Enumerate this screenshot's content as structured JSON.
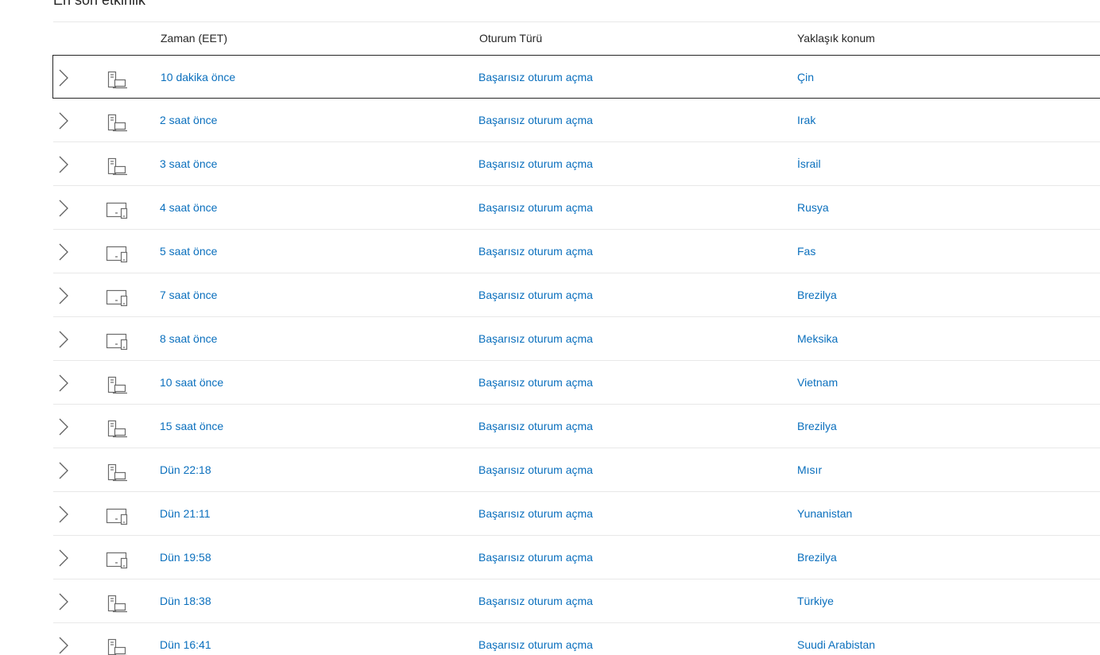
{
  "section": {
    "title": "En son etkinlik"
  },
  "columns": {
    "time": "Zaman (EET)",
    "session_type": "Oturum Türü",
    "location": "Yaklaşık konum"
  },
  "colors": {
    "link": "#0a6fbd",
    "text": "#262626",
    "divider": "#e8e8e8",
    "icon": "#6b6b6b"
  },
  "rows": [
    {
      "time": "10 dakika önce",
      "type": "Başarısız oturum açma",
      "location": "Çin",
      "device_icon": "desktop-laptop-icon"
    },
    {
      "time": "2 saat önce",
      "type": "Başarısız oturum açma",
      "location": "Irak",
      "device_icon": "desktop-laptop-icon"
    },
    {
      "time": "3 saat önce",
      "type": "Başarısız oturum açma",
      "location": "İsrail",
      "device_icon": "desktop-laptop-icon"
    },
    {
      "time": "4 saat önce",
      "type": "Başarısız oturum açma",
      "location": "Rusya",
      "device_icon": "monitor-phone-icon"
    },
    {
      "time": "5 saat önce",
      "type": "Başarısız oturum açma",
      "location": "Fas",
      "device_icon": "monitor-phone-icon"
    },
    {
      "time": "7 saat önce",
      "type": "Başarısız oturum açma",
      "location": "Brezilya",
      "device_icon": "monitor-phone-icon"
    },
    {
      "time": "8 saat önce",
      "type": "Başarısız oturum açma",
      "location": "Meksika",
      "device_icon": "monitor-phone-icon"
    },
    {
      "time": "10 saat önce",
      "type": "Başarısız oturum açma",
      "location": "Vietnam",
      "device_icon": "desktop-laptop-icon"
    },
    {
      "time": "15 saat önce",
      "type": "Başarısız oturum açma",
      "location": "Brezilya",
      "device_icon": "desktop-laptop-icon"
    },
    {
      "time": "Dün 22:18",
      "type": "Başarısız oturum açma",
      "location": "Mısır",
      "device_icon": "desktop-laptop-icon"
    },
    {
      "time": "Dün 21:11",
      "type": "Başarısız oturum açma",
      "location": "Yunanistan",
      "device_icon": "monitor-phone-icon"
    },
    {
      "time": "Dün 19:58",
      "type": "Başarısız oturum açma",
      "location": "Brezilya",
      "device_icon": "monitor-phone-icon"
    },
    {
      "time": "Dün 18:38",
      "type": "Başarısız oturum açma",
      "location": "Türkiye",
      "device_icon": "desktop-laptop-icon"
    },
    {
      "time": "Dün 16:41",
      "type": "Başarısız oturum açma",
      "location": "Suudi Arabistan",
      "device_icon": "desktop-laptop-icon"
    }
  ]
}
